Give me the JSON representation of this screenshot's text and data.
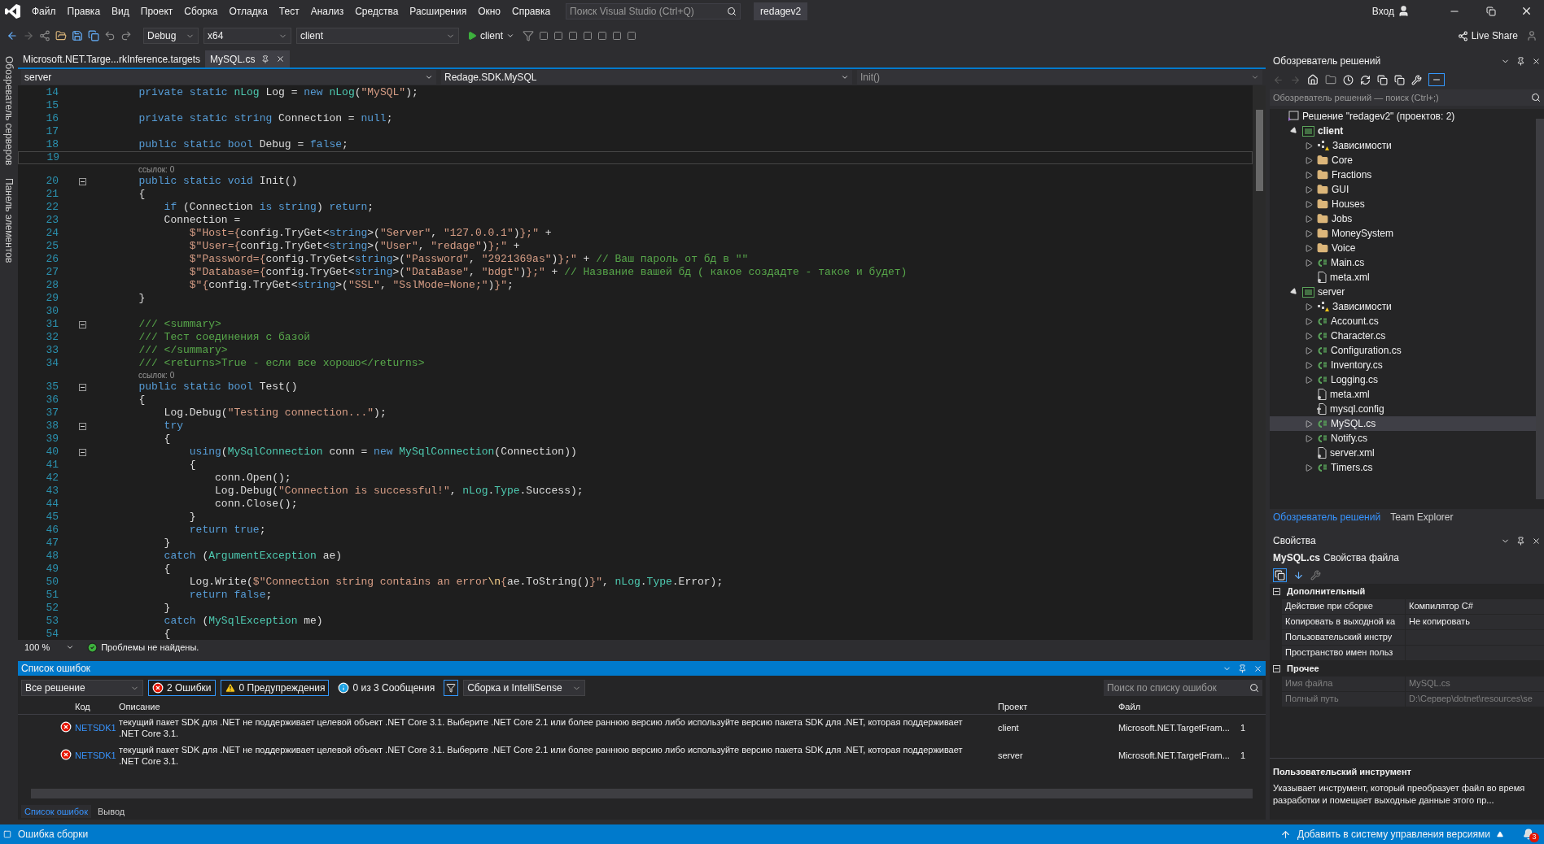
{
  "menu": [
    "Файл",
    "Правка",
    "Вид",
    "Проект",
    "Сборка",
    "Отладка",
    "Тест",
    "Анализ",
    "Средства",
    "Расширения",
    "Окно",
    "Справка"
  ],
  "search_box": {
    "placeholder": "Поиск Visual Studio (Ctrl+Q)"
  },
  "solution_name": "redagev2",
  "account": "Вход",
  "toolbar": {
    "config": "Debug",
    "platform": "x64",
    "startup": "client",
    "run": "client",
    "live_share": "Live Share"
  },
  "side_strip": [
    "Обозреватель серверов",
    "Панель элементов"
  ],
  "doc_tabs": [
    {
      "label": "Microsoft.NET.Targe...rkInference.targets",
      "selected": false
    },
    {
      "label": "MySQL.cs",
      "selected": true
    }
  ],
  "nav_bar": {
    "project": "server",
    "class": "Redage.SDK.MySQL",
    "member": "Init()"
  },
  "code_lines": [
    {
      "kind": "code",
      "number": "14",
      "tokens": [
        {
          "kind": "k",
          "text": "        private static "
        },
        {
          "kind": "t",
          "text": "nLog"
        },
        {
          "kind": "p",
          "text": " Log = "
        },
        {
          "kind": "k",
          "text": "new "
        },
        {
          "kind": "t",
          "text": "nLog"
        },
        {
          "kind": "p",
          "text": "("
        },
        {
          "kind": "s",
          "text": "\"MySQL\""
        },
        {
          "kind": "p",
          "text": ");"
        }
      ]
    },
    {
      "kind": "code",
      "number": "15"
    },
    {
      "kind": "code",
      "number": "16",
      "tokens": [
        {
          "kind": "k",
          "text": "        private static string "
        },
        {
          "kind": "p",
          "text": "Connection = "
        },
        {
          "kind": "k",
          "text": "null"
        },
        {
          "kind": "p",
          "text": ";"
        }
      ]
    },
    {
      "kind": "code",
      "number": "17"
    },
    {
      "kind": "code",
      "number": "18",
      "tokens": [
        {
          "kind": "k",
          "text": "        public static bool "
        },
        {
          "kind": "p",
          "text": "Debug = "
        },
        {
          "kind": "k",
          "text": "false"
        },
        {
          "kind": "p",
          "text": ";"
        }
      ]
    },
    {
      "kind": "code",
      "number": "19",
      "current": true
    },
    {
      "kind": "lens",
      "text": "ссылок: 0"
    },
    {
      "kind": "code",
      "number": "20",
      "fold": true,
      "tokens": [
        {
          "kind": "k",
          "text": "        public static void "
        },
        {
          "kind": "p",
          "text": "Init()"
        }
      ]
    },
    {
      "kind": "code",
      "number": "21",
      "tokens": [
        {
          "kind": "p",
          "text": "        {"
        }
      ]
    },
    {
      "kind": "code",
      "number": "22",
      "tokens": [
        {
          "kind": "k",
          "text": "            if "
        },
        {
          "kind": "p",
          "text": "(Connection "
        },
        {
          "kind": "k",
          "text": "is string"
        },
        {
          "kind": "p",
          "text": ") "
        },
        {
          "kind": "k",
          "text": "return"
        },
        {
          "kind": "p",
          "text": ";"
        }
      ]
    },
    {
      "kind": "code",
      "number": "23",
      "tokens": [
        {
          "kind": "p",
          "text": "            Connection ="
        }
      ]
    },
    {
      "kind": "code",
      "number": "24",
      "tokens": [
        {
          "kind": "s",
          "text": "                $\"Host={"
        },
        {
          "kind": "p",
          "text": "config.TryGet<"
        },
        {
          "kind": "k",
          "text": "string"
        },
        {
          "kind": "p",
          "text": ">("
        },
        {
          "kind": "s",
          "text": "\"Server\""
        },
        {
          "kind": "p",
          "text": ", "
        },
        {
          "kind": "s",
          "text": "\"127.0.0.1\""
        },
        {
          "kind": "p",
          "text": ")"
        },
        {
          "kind": "s",
          "text": "};\""
        },
        {
          "kind": "p",
          "text": " +"
        }
      ]
    },
    {
      "kind": "code",
      "number": "25",
      "tokens": [
        {
          "kind": "s",
          "text": "                $\"User={"
        },
        {
          "kind": "p",
          "text": "config.TryGet<"
        },
        {
          "kind": "k",
          "text": "string"
        },
        {
          "kind": "p",
          "text": ">("
        },
        {
          "kind": "s",
          "text": "\"User\""
        },
        {
          "kind": "p",
          "text": ", "
        },
        {
          "kind": "s",
          "text": "\"redage\""
        },
        {
          "kind": "p",
          "text": ")"
        },
        {
          "kind": "s",
          "text": "};\""
        },
        {
          "kind": "p",
          "text": " +"
        }
      ]
    },
    {
      "kind": "code",
      "number": "26",
      "tokens": [
        {
          "kind": "s",
          "text": "                $\"Password={"
        },
        {
          "kind": "p",
          "text": "config.TryGet<"
        },
        {
          "kind": "k",
          "text": "string"
        },
        {
          "kind": "p",
          "text": ">("
        },
        {
          "kind": "s",
          "text": "\"Password\""
        },
        {
          "kind": "p",
          "text": ", "
        },
        {
          "kind": "s",
          "text": "\"2921369as\""
        },
        {
          "kind": "p",
          "text": ")"
        },
        {
          "kind": "s",
          "text": "};\""
        },
        {
          "kind": "p",
          "text": " + "
        },
        {
          "kind": "c",
          "text": "// Ваш пароль от бд в \"\""
        }
      ]
    },
    {
      "kind": "code",
      "number": "27",
      "tokens": [
        {
          "kind": "s",
          "text": "                $\"Database={"
        },
        {
          "kind": "p",
          "text": "config.TryGet<"
        },
        {
          "kind": "k",
          "text": "string"
        },
        {
          "kind": "p",
          "text": ">("
        },
        {
          "kind": "s",
          "text": "\"DataBase\""
        },
        {
          "kind": "p",
          "text": ", "
        },
        {
          "kind": "s",
          "text": "\"bdgt\""
        },
        {
          "kind": "p",
          "text": ")"
        },
        {
          "kind": "s",
          "text": "};\""
        },
        {
          "kind": "p",
          "text": " + "
        },
        {
          "kind": "c",
          "text": "// Название вашей бд ( какое создадте - такое и будет)"
        }
      ]
    },
    {
      "kind": "code",
      "number": "28",
      "tokens": [
        {
          "kind": "s",
          "text": "                $\"{"
        },
        {
          "kind": "p",
          "text": "config.TryGet<"
        },
        {
          "kind": "k",
          "text": "string"
        },
        {
          "kind": "p",
          "text": ">("
        },
        {
          "kind": "s",
          "text": "\"SSL\""
        },
        {
          "kind": "p",
          "text": ", "
        },
        {
          "kind": "s",
          "text": "\"SslMode=None;\""
        },
        {
          "kind": "p",
          "text": ")"
        },
        {
          "kind": "s",
          "text": "}\""
        },
        {
          "kind": "p",
          "text": ";"
        }
      ]
    },
    {
      "kind": "code",
      "number": "29",
      "tokens": [
        {
          "kind": "p",
          "text": "        }"
        }
      ]
    },
    {
      "kind": "code",
      "number": "30"
    },
    {
      "kind": "code",
      "number": "31",
      "fold": true,
      "tokens": [
        {
          "kind": "c",
          "text": "        /// <summary>"
        }
      ]
    },
    {
      "kind": "code",
      "number": "32",
      "tokens": [
        {
          "kind": "c",
          "text": "        /// Тест соединения с базой"
        }
      ]
    },
    {
      "kind": "code",
      "number": "33",
      "tokens": [
        {
          "kind": "c",
          "text": "        /// </summary>"
        }
      ]
    },
    {
      "kind": "code",
      "number": "34",
      "tokens": [
        {
          "kind": "c",
          "text": "        /// <returns>True - если все хорошо</returns>"
        }
      ]
    },
    {
      "kind": "lens",
      "text": "ссылок: 0"
    },
    {
      "kind": "code",
      "number": "35",
      "fold": true,
      "tokens": [
        {
          "kind": "k",
          "text": "        public static bool "
        },
        {
          "kind": "p",
          "text": "Test()"
        }
      ]
    },
    {
      "kind": "code",
      "number": "36",
      "tokens": [
        {
          "kind": "p",
          "text": "        {"
        }
      ]
    },
    {
      "kind": "code",
      "number": "37",
      "tokens": [
        {
          "kind": "p",
          "text": "            Log.Debug("
        },
        {
          "kind": "s",
          "text": "\"Testing connection...\""
        },
        {
          "kind": "p",
          "text": ");"
        }
      ]
    },
    {
      "kind": "code",
      "number": "38",
      "fold": true,
      "tokens": [
        {
          "kind": "k",
          "text": "            try"
        }
      ]
    },
    {
      "kind": "code",
      "number": "39",
      "tokens": [
        {
          "kind": "p",
          "text": "            {"
        }
      ]
    },
    {
      "kind": "code",
      "number": "40",
      "fold": true,
      "tokens": [
        {
          "kind": "k",
          "text": "                using"
        },
        {
          "kind": "p",
          "text": "("
        },
        {
          "kind": "t",
          "text": "MySqlConnection"
        },
        {
          "kind": "p",
          "text": " conn = "
        },
        {
          "kind": "k",
          "text": "new "
        },
        {
          "kind": "t",
          "text": "MySqlConnection"
        },
        {
          "kind": "p",
          "text": "(Connection))"
        }
      ]
    },
    {
      "kind": "code",
      "number": "41",
      "tokens": [
        {
          "kind": "p",
          "text": "                {"
        }
      ]
    },
    {
      "kind": "code",
      "number": "42",
      "tokens": [
        {
          "kind": "p",
          "text": "                    conn.Open();"
        }
      ]
    },
    {
      "kind": "code",
      "number": "43",
      "tokens": [
        {
          "kind": "p",
          "text": "                    Log.Debug("
        },
        {
          "kind": "s",
          "text": "\"Connection is successful!\""
        },
        {
          "kind": "p",
          "text": ", "
        },
        {
          "kind": "t",
          "text": "nLog"
        },
        {
          "kind": "p",
          "text": "."
        },
        {
          "kind": "t",
          "text": "Type"
        },
        {
          "kind": "p",
          "text": ".Success);"
        }
      ]
    },
    {
      "kind": "code",
      "number": "44",
      "tokens": [
        {
          "kind": "p",
          "text": "                    conn.Close();"
        }
      ]
    },
    {
      "kind": "code",
      "number": "45",
      "tokens": [
        {
          "kind": "p",
          "text": "                }"
        }
      ]
    },
    {
      "kind": "code",
      "number": "46",
      "tokens": [
        {
          "kind": "k",
          "text": "                return true"
        },
        {
          "kind": "p",
          "text": ";"
        }
      ]
    },
    {
      "kind": "code",
      "number": "47",
      "tokens": [
        {
          "kind": "p",
          "text": "            }"
        }
      ]
    },
    {
      "kind": "code",
      "number": "48",
      "tokens": [
        {
          "kind": "k",
          "text": "            catch "
        },
        {
          "kind": "p",
          "text": "("
        },
        {
          "kind": "t",
          "text": "ArgumentException"
        },
        {
          "kind": "p",
          "text": " ae)"
        }
      ]
    },
    {
      "kind": "code",
      "number": "49",
      "tokens": [
        {
          "kind": "p",
          "text": "            {"
        }
      ]
    },
    {
      "kind": "code",
      "number": "50",
      "tokens": [
        {
          "kind": "p",
          "text": "                Log.Write("
        },
        {
          "kind": "s",
          "text": "$\"Connection string contains an error"
        },
        {
          "kind": "e",
          "text": "\\n"
        },
        {
          "kind": "s",
          "text": "{"
        },
        {
          "kind": "p",
          "text": "ae.ToString()"
        },
        {
          "kind": "s",
          "text": "}\""
        },
        {
          "kind": "p",
          "text": ", "
        },
        {
          "kind": "t",
          "text": "nLog"
        },
        {
          "kind": "p",
          "text": "."
        },
        {
          "kind": "t",
          "text": "Type"
        },
        {
          "kind": "p",
          "text": ".Error);"
        }
      ]
    },
    {
      "kind": "code",
      "number": "51",
      "tokens": [
        {
          "kind": "k",
          "text": "                return false"
        },
        {
          "kind": "p",
          "text": ";"
        }
      ]
    },
    {
      "kind": "code",
      "number": "52",
      "tokens": [
        {
          "kind": "p",
          "text": "            }"
        }
      ]
    },
    {
      "kind": "code",
      "number": "53",
      "tokens": [
        {
          "kind": "k",
          "text": "            catch "
        },
        {
          "kind": "p",
          "text": "("
        },
        {
          "kind": "t",
          "text": "MySqlException"
        },
        {
          "kind": "p",
          "text": " me)"
        }
      ]
    },
    {
      "kind": "code",
      "number": "54",
      "tokens": [
        {
          "kind": "p",
          "text": "            {"
        }
      ]
    }
  ],
  "editor_status": {
    "zoom": "100 %",
    "issues": "Проблемы не найдены."
  },
  "error_list": {
    "title": "Список ошибок",
    "scope": "Все решение",
    "filters": [
      {
        "kind": "error",
        "label": "2 Ошибки",
        "selected": true
      },
      {
        "kind": "warning",
        "label": "0 Предупреждения",
        "selected": true
      },
      {
        "kind": "info",
        "label": "0 из 3 Сообщения",
        "selected": false
      }
    ],
    "source": "Сборка и IntelliSense",
    "search": {
      "placeholder": "Поиск по списку ошибок"
    },
    "columns": [
      "Код",
      "Описание",
      "Проект",
      "Файл"
    ],
    "rows": [
      {
        "code": "NETSDK1",
        "description": "текущий пакет SDK для .NET не поддерживает целевой объект .NET Core 3.1. Выберите .NET Core 2.1 или более раннюю версию либо используйте версию пакета SDK для .NET, которая поддерживает .NET Core 3.1.",
        "project": "client",
        "file": "Microsoft.NET.TargetFram...",
        "column_5": "1"
      },
      {
        "code": "NETSDK1",
        "description": "текущий пакет SDK для .NET не поддерживает целевой объект .NET Core 3.1. Выберите .NET Core 2.1 или более раннюю версию либо используйте версию пакета SDK для .NET, которая поддерживает .NET Core 3.1.",
        "project": "server",
        "file": "Microsoft.NET.TargetFram...",
        "column_5": "1"
      }
    ]
  },
  "bottom_tabs": [
    {
      "label": "Список ошибок",
      "selected": true
    },
    {
      "label": "Вывод",
      "selected": false
    }
  ],
  "solution_explorer": {
    "title": "Обозреватель решений",
    "search": {
      "placeholder": "Обозреватель решений — поиск (Ctrl+;)"
    },
    "tree": [
      {
        "kind": "solution",
        "label": "Решение \"redagev2\"  (проектов: 2)",
        "selected": false,
        "children": [
          {
            "kind": "project",
            "label": "client",
            "startup": true,
            "expanded": true,
            "selected": false,
            "children": [
              {
                "kind": "deps",
                "label": "Зависимости",
                "expanded": false,
                "selected": false
              },
              {
                "kind": "folder",
                "label": "Core",
                "expanded": false,
                "selected": false
              },
              {
                "kind": "folder",
                "label": "Fractions",
                "expanded": false,
                "selected": false
              },
              {
                "kind": "folder",
                "label": "GUI",
                "expanded": false,
                "selected": false
              },
              {
                "kind": "folder",
                "label": "Houses",
                "expanded": false,
                "selected": false
              },
              {
                "kind": "folder",
                "label": "Jobs",
                "expanded": false,
                "selected": false
              },
              {
                "kind": "folder",
                "label": "MoneySystem",
                "expanded": false,
                "selected": false
              },
              {
                "kind": "folder",
                "label": "Voice",
                "expanded": false,
                "selected": false
              },
              {
                "kind": "cs",
                "label": "Main.cs",
                "expanded": false,
                "selected": false
              },
              {
                "kind": "file",
                "label": "meta.xml",
                "selected": false
              }
            ]
          },
          {
            "kind": "project",
            "label": "server",
            "startup": false,
            "expanded": true,
            "selected": false,
            "children": [
              {
                "kind": "deps",
                "label": "Зависимости",
                "expanded": false,
                "selected": false
              },
              {
                "kind": "cs",
                "label": "Account.cs",
                "expanded": false,
                "selected": false
              },
              {
                "kind": "cs",
                "label": "Character.cs",
                "expanded": false,
                "selected": false
              },
              {
                "kind": "cs",
                "label": "Configuration.cs",
                "expanded": false,
                "selected": false
              },
              {
                "kind": "cs",
                "label": "Inventory.cs",
                "expanded": false,
                "selected": false
              },
              {
                "kind": "cs",
                "label": "Logging.cs",
                "expanded": false,
                "selected": false
              },
              {
                "kind": "file",
                "label": "meta.xml",
                "selected": false
              },
              {
                "kind": "config",
                "label": "mysql.config",
                "selected": false
              },
              {
                "kind": "cs",
                "label": "MySQL.cs",
                "expanded": false,
                "selected": true
              },
              {
                "kind": "cs",
                "label": "Notify.cs",
                "expanded": false,
                "selected": false
              },
              {
                "kind": "file",
                "label": "server.xml",
                "selected": false
              },
              {
                "kind": "cs",
                "label": "Timers.cs",
                "expanded": false,
                "selected": false
              }
            ]
          }
        ]
      }
    ],
    "tabs": [
      {
        "label": "Обозреватель решений",
        "selected": true
      },
      {
        "label": "Team Explorer",
        "selected": false
      }
    ]
  },
  "properties": {
    "title": "Свойства",
    "object": "MySQL.cs",
    "object_type": "Свойства файла",
    "categories": [
      {
        "name": "Дополнительный",
        "expanded": true,
        "rows": [
          {
            "name": "Действие при сборке",
            "value": "Компилятор C#",
            "readonly": false
          },
          {
            "name": "Копировать в выходной ка",
            "value": "Не копировать",
            "readonly": false
          },
          {
            "name": "Пользовательский инстру",
            "readonly": false
          },
          {
            "name": "Пространство имен польз",
            "readonly": false
          }
        ]
      },
      {
        "name": "Прочее",
        "expanded": true,
        "rows": [
          {
            "name": "Имя файла",
            "value": "MySQL.cs",
            "readonly": true
          },
          {
            "name": "Полный путь",
            "value": "D:\\Сервер\\dotnet\\resources\\se",
            "readonly": true
          }
        ]
      }
    ],
    "description": {
      "title": "Пользовательский инструмент",
      "text": "Указывает инструмент, который преобразует файл во время разработки и помещает выходные данные этого пр..."
    }
  },
  "status_bar": {
    "left": "Ошибка сборки",
    "right": "Добавить в систему управления версиями",
    "notifications": "3"
  }
}
